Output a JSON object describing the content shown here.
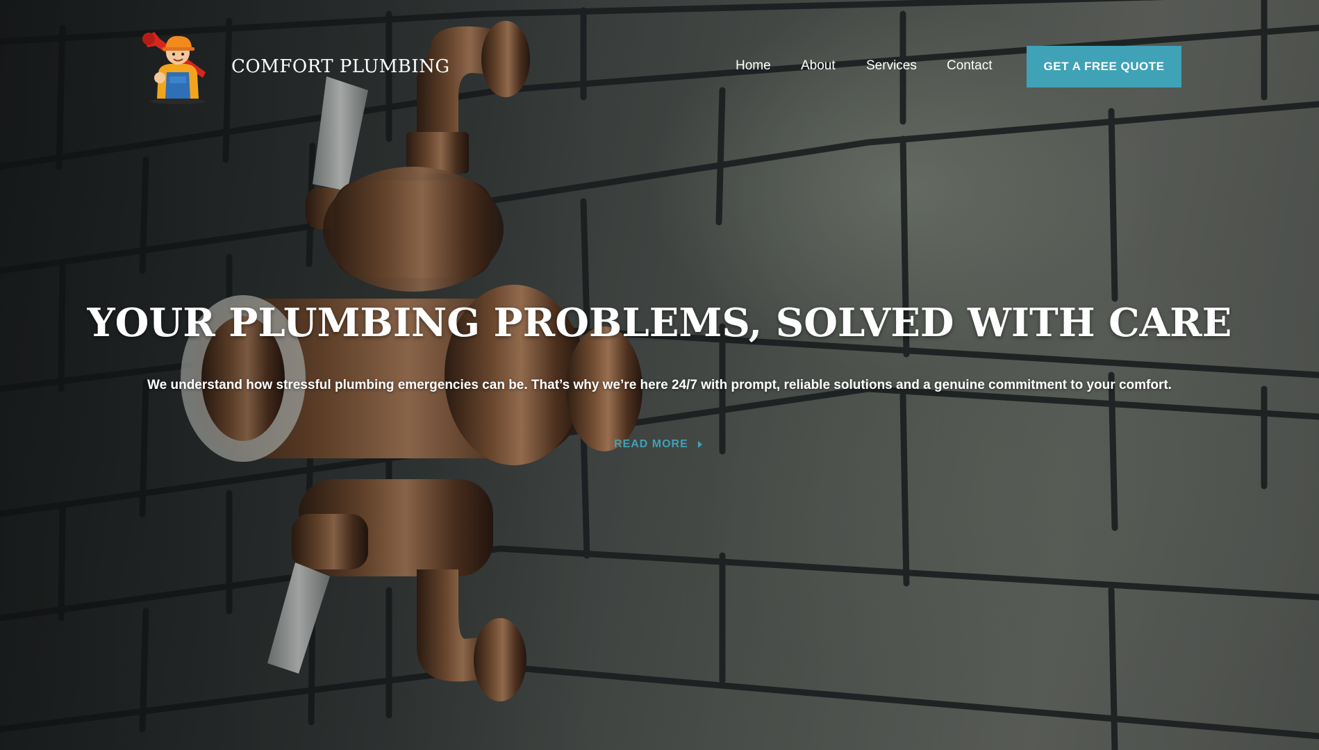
{
  "brand": {
    "name": "COMFORT PLUMBING",
    "logo_icon": "plumber-mascot-icon"
  },
  "nav": {
    "items": [
      {
        "label": "Home"
      },
      {
        "label": "About"
      },
      {
        "label": "Services"
      },
      {
        "label": "Contact"
      }
    ],
    "cta_label": "GET A FREE QUOTE"
  },
  "hero": {
    "headline": "YOUR PLUMBING PROBLEMS, SOLVED WITH CARE",
    "subtext": "We understand how stressful plumbing emergencies can be. That’s why we’re here 24/7 with prompt, reliable solutions and a genuine commitment to your comfort.",
    "read_more_label": "READ MORE",
    "read_more_icon": "caret-right-icon",
    "background_image": "brass-shower-valve-on-tiled-wall"
  },
  "colors": {
    "accent": "#3fa2b6",
    "text": "#ffffff"
  }
}
